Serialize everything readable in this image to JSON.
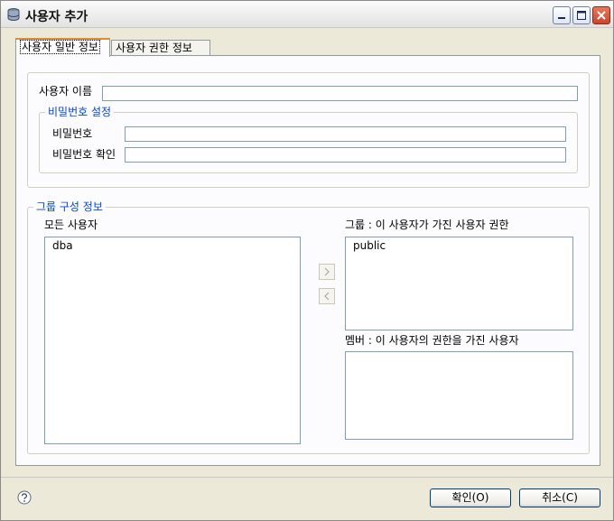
{
  "window": {
    "title": "사용자 추가"
  },
  "tabs": [
    {
      "label": "사용자 일반 정보",
      "active": true
    },
    {
      "label": "사용자 권한 정보",
      "active": false
    }
  ],
  "general": {
    "username_label": "사용자 이름",
    "username_value": "",
    "password_group_legend": "비밀번호 설정",
    "password_label": "비밀번호",
    "password_value": "",
    "confirm_label": "비밀번호 확인",
    "confirm_value": ""
  },
  "group_info": {
    "legend": "그룹 구성 정보",
    "all_users_label": "모든 사용자",
    "all_users": [
      "dba"
    ],
    "groups_label": "그룹 : 이 사용자가 가진 사용자 권한",
    "groups": [
      "public"
    ],
    "members_label": "멤버 : 이 사용자의 권한을 가진 사용자",
    "members": []
  },
  "buttons": {
    "ok": "확인(O)",
    "cancel": "취소(C)"
  },
  "icons": {
    "app": "database-icon",
    "help": "help-icon",
    "add": "chevron-right-icon",
    "remove": "chevron-left-icon"
  }
}
